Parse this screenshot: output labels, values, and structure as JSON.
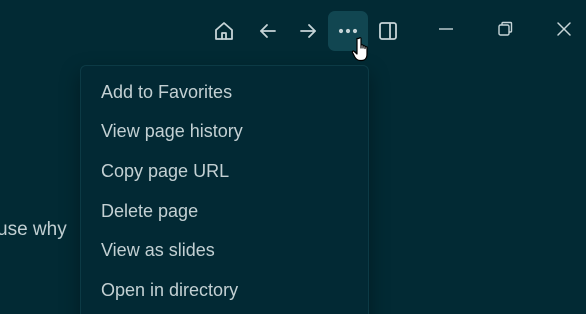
{
  "toolbar": {
    "icons": [
      "home-icon",
      "arrow-left-icon",
      "arrow-right-icon",
      "more-horizontal-icon",
      "sidebar-panel-icon"
    ]
  },
  "window_controls": {
    "icons": [
      "minimize-icon",
      "restore-icon",
      "close-icon"
    ]
  },
  "background": {
    "text_fragment": "use why"
  },
  "menu": {
    "items": [
      {
        "label": "Add to Favorites"
      },
      {
        "label": "View page history"
      },
      {
        "label": "Copy page URL"
      },
      {
        "label": "Delete page"
      },
      {
        "label": "View as slides"
      },
      {
        "label": "Open in directory"
      }
    ]
  },
  "colors": {
    "background": "#022a34",
    "active_button": "#114651",
    "text": "#c3d0d3",
    "menu_border": "#0c3a45"
  }
}
